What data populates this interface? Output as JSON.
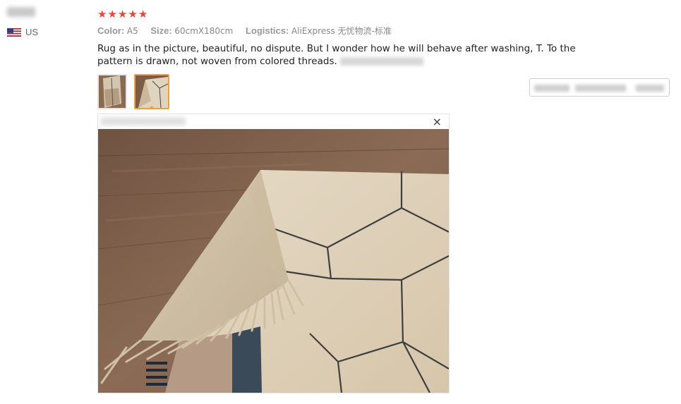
{
  "user": {
    "country": "US"
  },
  "review": {
    "rating": 5,
    "stars": [
      "★",
      "★",
      "★",
      "★",
      "★"
    ],
    "color_label": "Color:",
    "color_value": "A5",
    "size_label": "Size:",
    "size_value": "60cmX180cm",
    "logistics_label": "Logistics:",
    "logistics_value": "AliExpress 无忧物流-标准",
    "text": "Rug as in the picture, beautiful, no dispute. But I wonder how he will behave after washing, T. To the pattern is drawn, not woven from colored threads."
  },
  "viewer": {
    "close_glyph": "×"
  },
  "colors": {
    "star": "#f44336",
    "active_thumb_border": "#f3a03a"
  }
}
